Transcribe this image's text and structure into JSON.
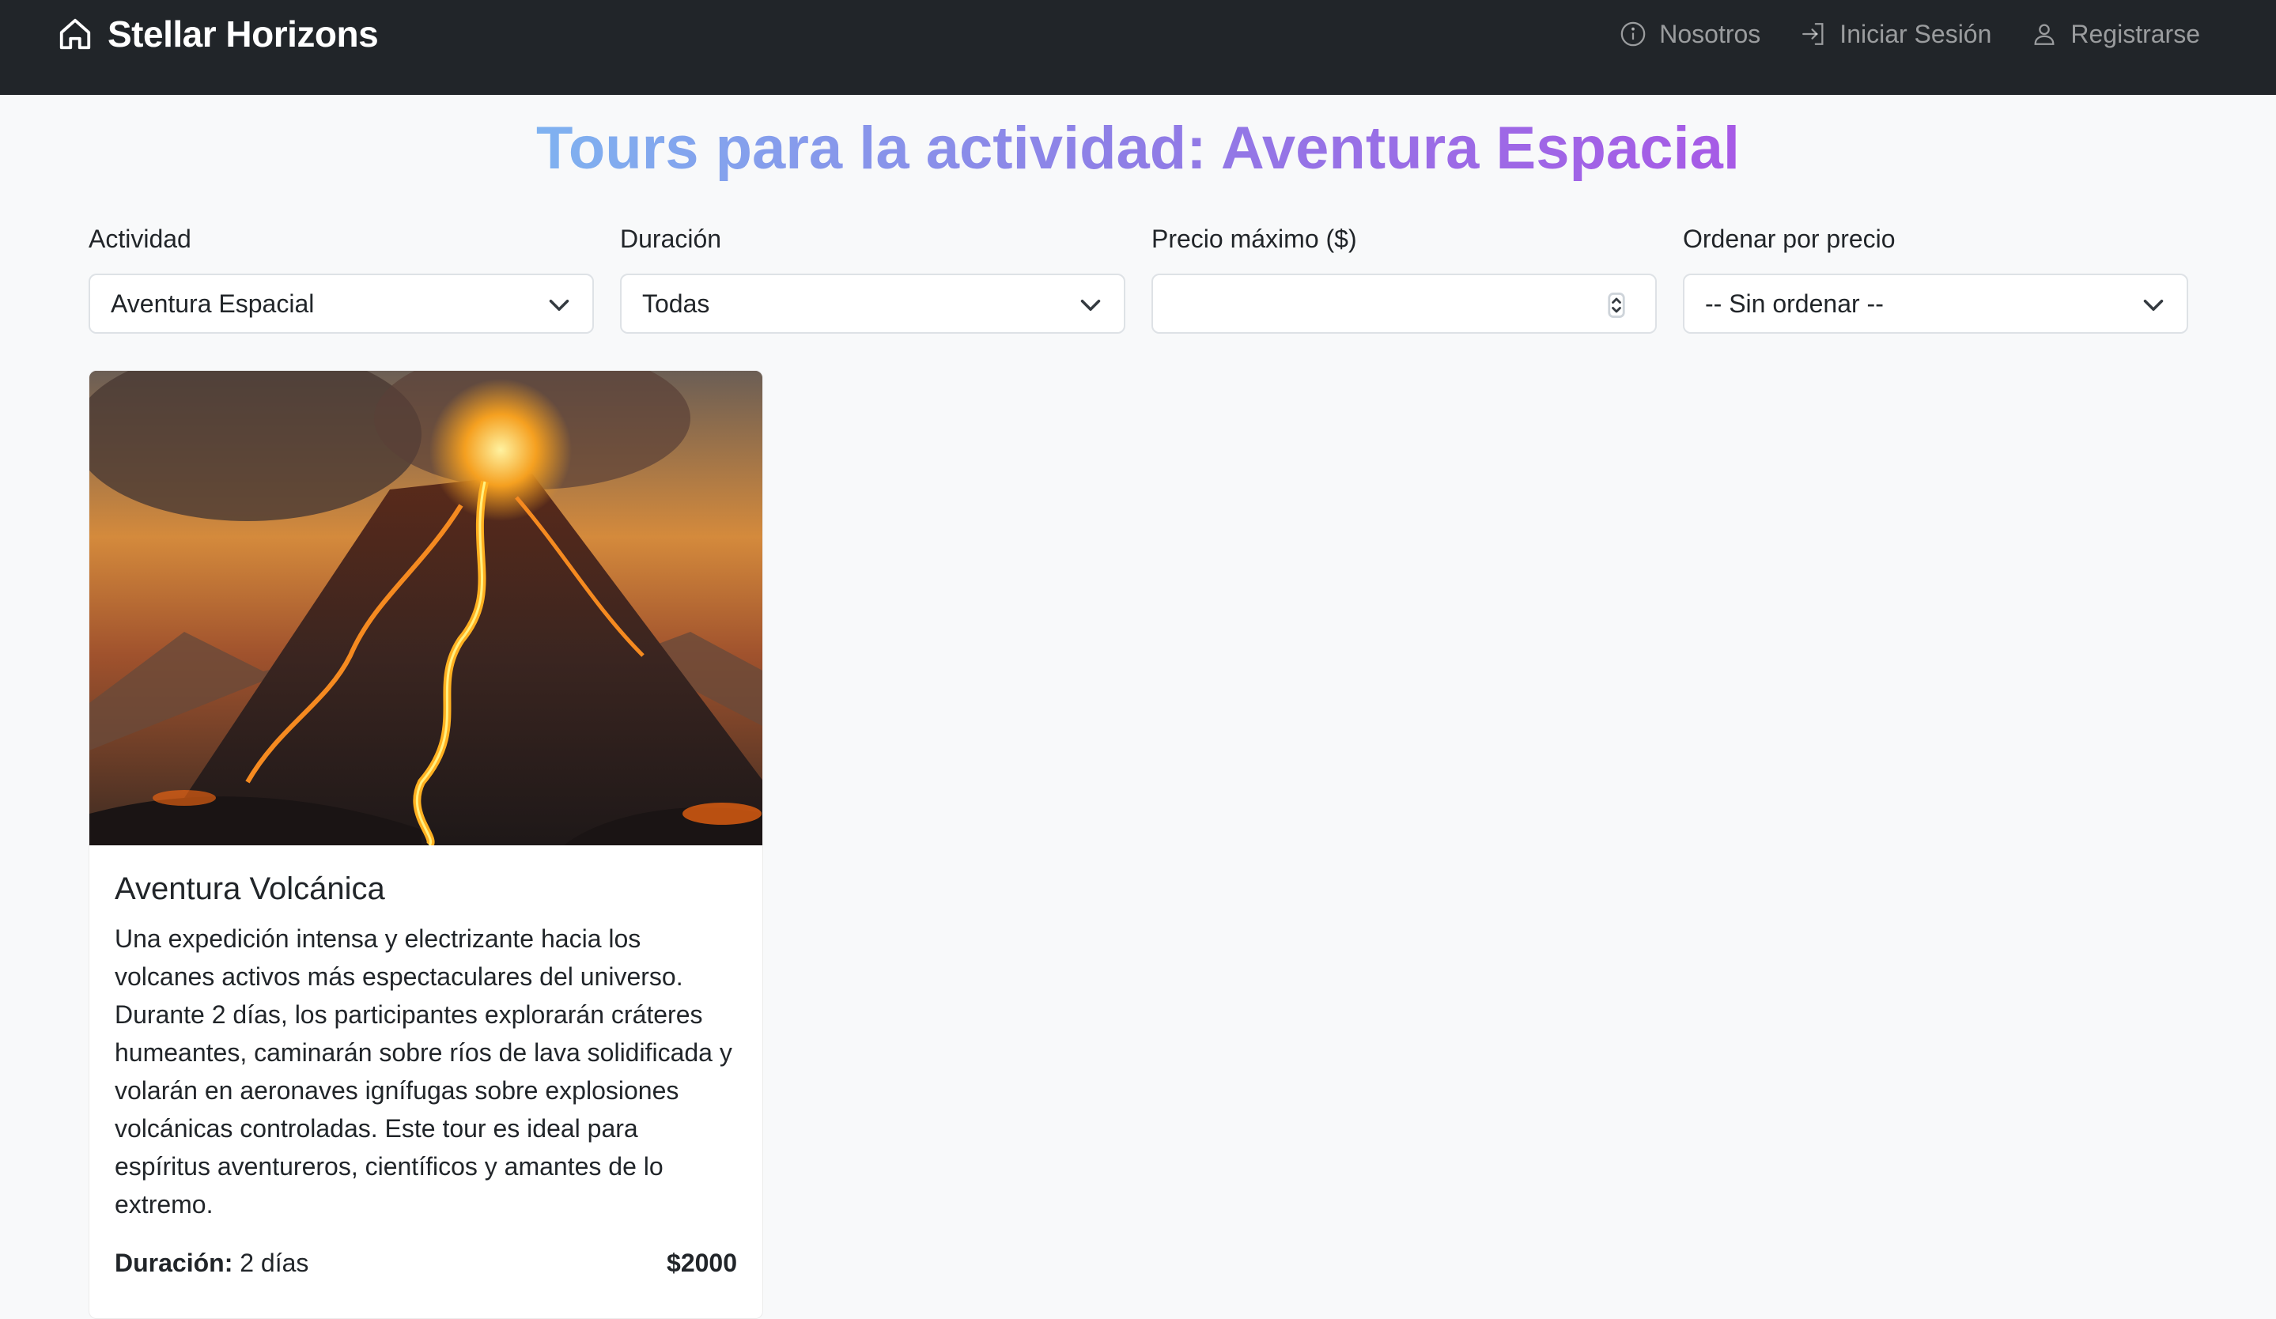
{
  "navbar": {
    "brand": "Stellar Horizons",
    "links": [
      {
        "label": "Nosotros",
        "icon": "info-circle-icon"
      },
      {
        "label": "Iniciar Sesión",
        "icon": "login-arrow-icon"
      },
      {
        "label": "Registrarse",
        "icon": "person-icon"
      }
    ]
  },
  "page": {
    "title": "Tours para la actividad: Aventura Espacial"
  },
  "filters": {
    "activity": {
      "label": "Actividad",
      "value": "Aventura Espacial"
    },
    "duration": {
      "label": "Duración",
      "value": "Todas"
    },
    "max_price": {
      "label": "Precio máximo ($)",
      "value": ""
    },
    "sort": {
      "label": "Ordenar por precio",
      "value": "-- Sin ordenar --"
    }
  },
  "tours": [
    {
      "title": "Aventura Volcánica",
      "description": "Una expedición intensa y electrizante hacia los volcanes activos más espectaculares del universo. Durante 2 días, los participantes explorarán cráteres humeantes, caminarán sobre ríos de lava solidificada y volarán en aeronaves ignífugas sobre explosiones volcánicas controladas. Este tour es ideal para espíritus aventureros, científicos y amantes de lo extremo.",
      "duration_label": "Duración:",
      "duration_value": "2 días",
      "price": "$2000"
    }
  ],
  "colors": {
    "navbar_bg": "#212529",
    "page_bg": "#f8f9fa",
    "title_gradient_start": "#7fb2f0",
    "title_gradient_end": "#a75ae6"
  }
}
